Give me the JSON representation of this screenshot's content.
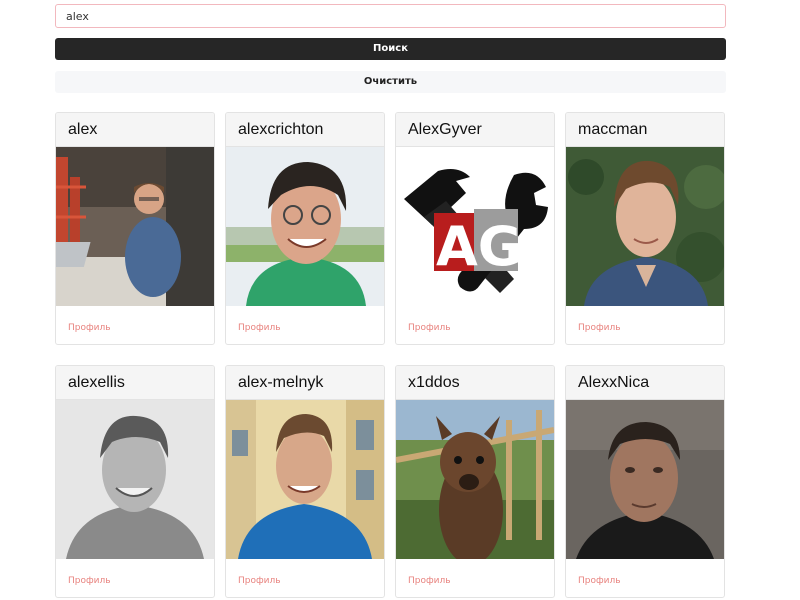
{
  "search": {
    "value": "alex",
    "button_label": "Поиск",
    "clear_label": "Очистить"
  },
  "users": [
    {
      "name": "alex",
      "link_label": "Профиль"
    },
    {
      "name": "alexcrichton",
      "link_label": "Профиль"
    },
    {
      "name": "AlexGyver",
      "link_label": "Профиль"
    },
    {
      "name": "maccman",
      "link_label": "Профиль"
    },
    {
      "name": "alexellis",
      "link_label": "Профиль"
    },
    {
      "name": "alex-melnyk",
      "link_label": "Профиль"
    },
    {
      "name": "x1ddos",
      "link_label": "Профиль"
    },
    {
      "name": "AlexxNica",
      "link_label": "Профиль"
    }
  ],
  "logo_text": "AG",
  "colors": {
    "search_button_bg": "#262626",
    "clear_button_bg": "#f6f7f9",
    "link_color": "#e8837f",
    "input_border": "#f2b8be"
  }
}
